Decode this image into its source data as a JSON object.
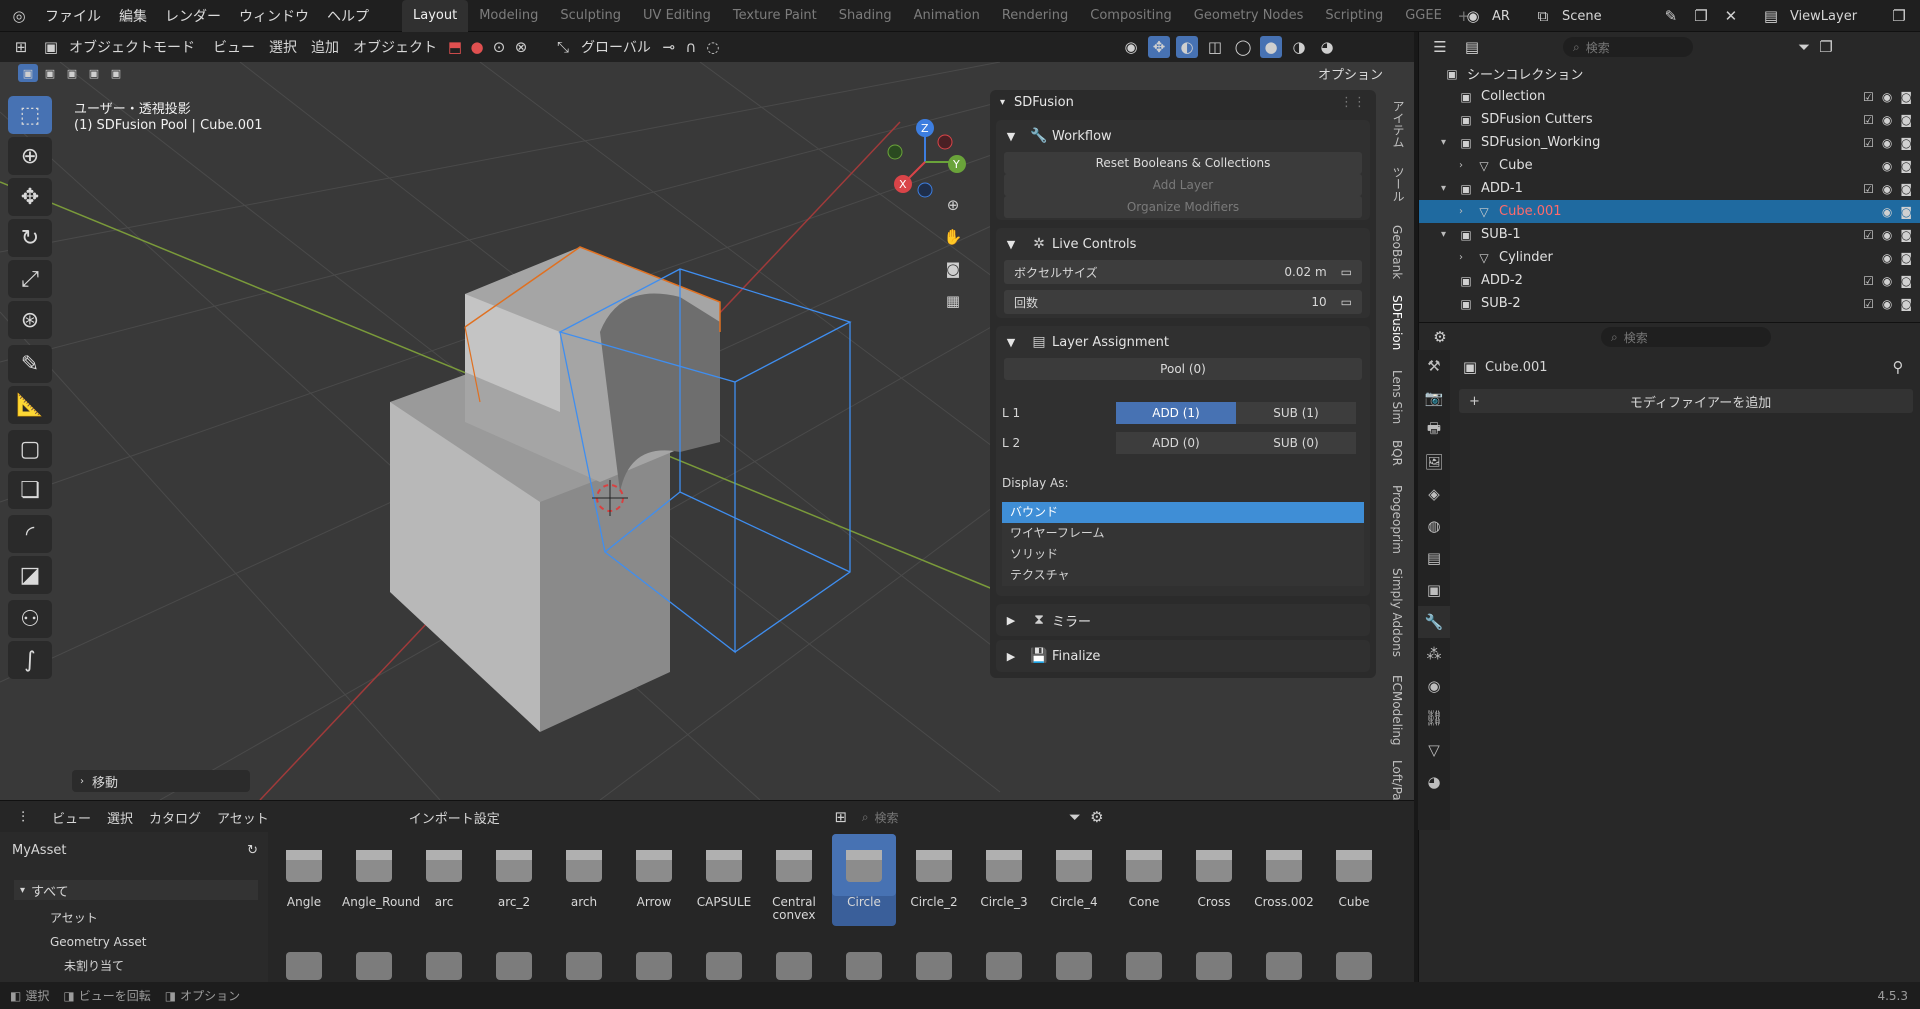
{
  "topbar": {
    "menus": [
      "ファイル",
      "編集",
      "レンダー",
      "ウィンドウ",
      "ヘルプ"
    ],
    "workspaces": [
      "Layout",
      "Modeling",
      "Sculpting",
      "UV Editing",
      "Texture Paint",
      "Shading",
      "Animation",
      "Rendering",
      "Compositing",
      "Geometry Nodes",
      "Scripting",
      "GGEE"
    ],
    "active_workspace": "Layout",
    "ar_label": "AR",
    "scene_label": "Scene",
    "viewlayer_label": "ViewLayer"
  },
  "viewport_header": {
    "mode": "オブジェクトモード",
    "menus": [
      "ビュー",
      "選択",
      "追加",
      "オブジェクト"
    ],
    "orientation": "グローバル",
    "options": "オプション"
  },
  "viewport": {
    "view_name": "ユーザー・透視投影",
    "object_info": "(1) SDFusion Pool | Cube.001",
    "last_op": "移動",
    "gizmo": {
      "x": "X",
      "y": "Y",
      "z": "Z"
    }
  },
  "sdfusion_panel": {
    "title": "SDFusion",
    "workflow": {
      "header": "Workflow",
      "reset": "Reset Booleans & Collections",
      "add_layer": "Add Layer",
      "organize": "Organize Modifiers"
    },
    "live_controls": {
      "header": "Live Controls",
      "voxel_label": "ボクセルサイズ",
      "voxel_value": "0.02 m",
      "iter_label": "回数",
      "iter_value": "10"
    },
    "layer_assignment": {
      "header": "Layer Assignment",
      "pool": "Pool (0)",
      "l1": "L 1",
      "l1_add": "ADD (1)",
      "l1_sub": "SUB (1)",
      "l2": "L 2",
      "l2_add": "ADD (0)",
      "l2_sub": "SUB (0)"
    },
    "display_as": {
      "label": "Display As:",
      "items": [
        "バウンド",
        "ワイヤーフレーム",
        "ソリッド",
        "テクスチャ"
      ],
      "selected": "バウンド"
    },
    "mirror": "ミラー",
    "finalize": "Finalize"
  },
  "side_tabs": [
    "アイテム",
    "ツール",
    "GeoBank",
    "SDFusion",
    "Lens Sim",
    "BQR",
    "Progeoprim",
    "Simply Addons",
    "ECModeling",
    "Loft/Pa"
  ],
  "outliner": {
    "search_placeholder": "検索",
    "scene_collection": "シーンコレクション",
    "rows": [
      {
        "label": "Collection",
        "indent": 1,
        "type": "collection"
      },
      {
        "label": "SDFusion Cutters",
        "indent": 1,
        "type": "collection"
      },
      {
        "label": "SDFusion_Working",
        "indent": 1,
        "type": "collection",
        "expanded": true
      },
      {
        "label": "Cube",
        "indent": 2,
        "type": "mesh"
      },
      {
        "label": "ADD-1",
        "indent": 1,
        "type": "collection",
        "expanded": true
      },
      {
        "label": "Cube.001",
        "indent": 2,
        "type": "mesh",
        "selected": true
      },
      {
        "label": "SUB-1",
        "indent": 1,
        "type": "collection",
        "expanded": true
      },
      {
        "label": "Cylinder",
        "indent": 2,
        "type": "mesh"
      },
      {
        "label": "ADD-2",
        "indent": 1,
        "type": "collection"
      },
      {
        "label": "SUB-2",
        "indent": 1,
        "type": "collection"
      }
    ]
  },
  "properties": {
    "search_placeholder": "検索",
    "object_name": "Cube.001",
    "add_modifier": "モディファイアーを追加"
  },
  "asset_browser": {
    "menus": [
      "ビュー",
      "選択",
      "カタログ",
      "アセット"
    ],
    "import_settings": "インポート設定",
    "search_placeholder": "検索",
    "library": "MyAsset",
    "catalog_all": "すべて",
    "catalog_items": [
      "アセット",
      "Geometry Asset",
      "未割り当て"
    ],
    "assets": [
      "Angle",
      "Angle_Round",
      "arc",
      "arc_2",
      "arch",
      "Arrow",
      "CAPSULE",
      "Central convex",
      "Circle",
      "Circle_2",
      "Circle_3",
      "Circle_4",
      "Cone",
      "Cross",
      "Cross.002",
      "Cube"
    ],
    "selected_asset": "Circle"
  },
  "statusbar": {
    "items": [
      "選択",
      "ビューを回転",
      "オプション"
    ],
    "version": "4.5.3"
  },
  "colors": {
    "accent": "#4772b3",
    "selected_row": "#1f6aa0",
    "active_object": "#ff6b6b"
  }
}
